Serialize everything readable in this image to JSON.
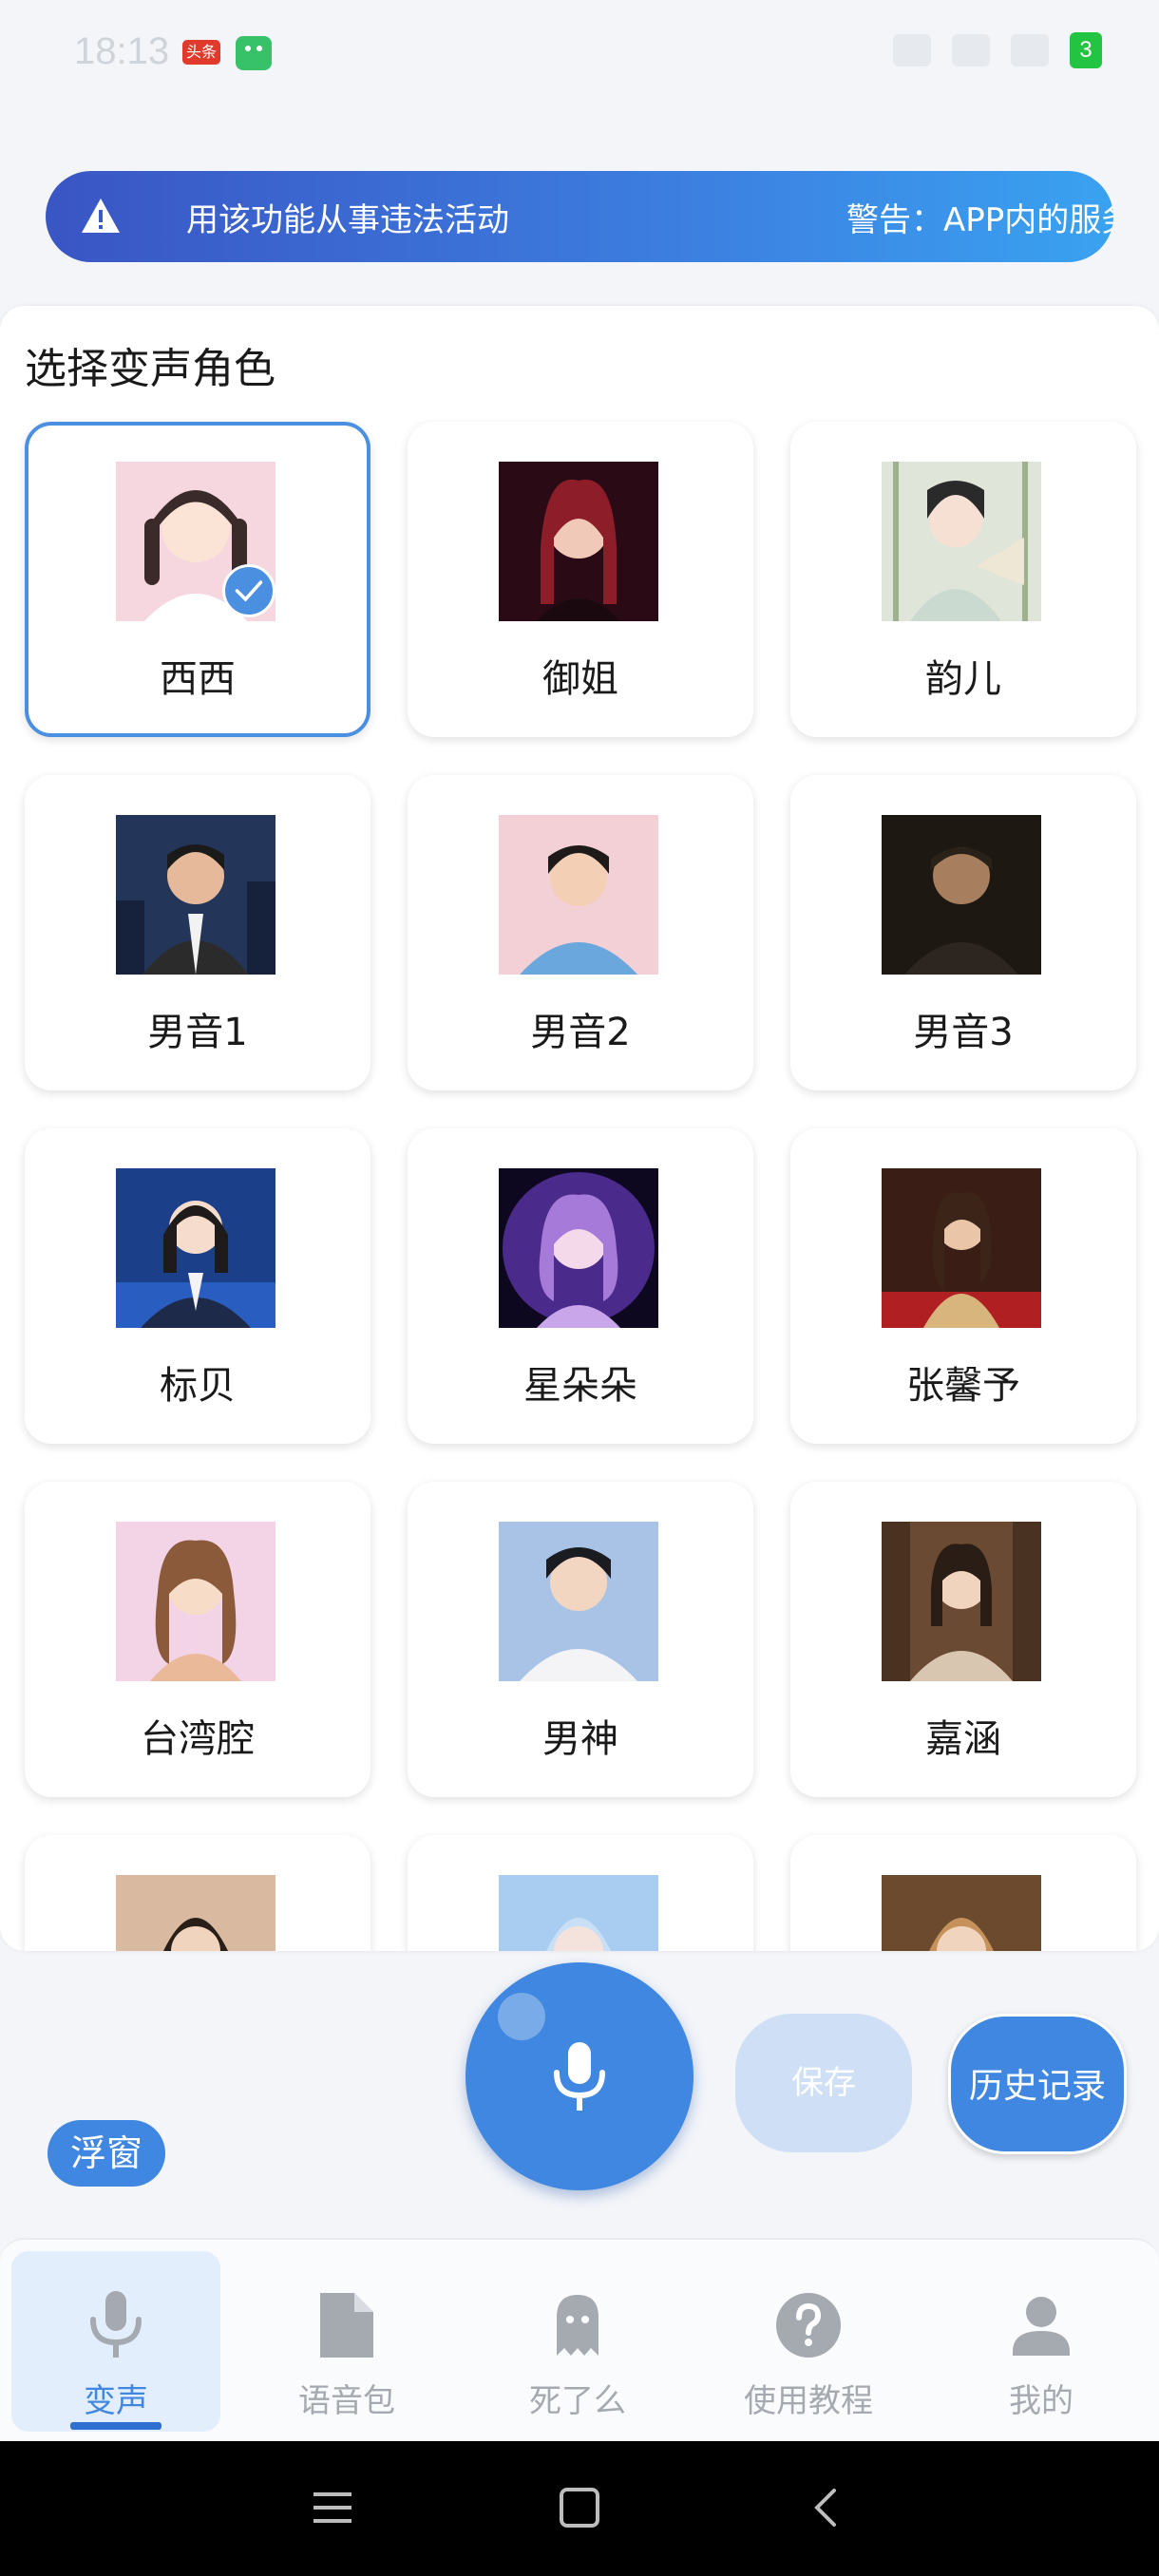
{
  "status_bar": {
    "time": "18:13",
    "badge_text": "头条",
    "battery": "3"
  },
  "banner": {
    "text_1": "用该功能从事违法活动",
    "text_2": "警告：APP内的服务"
  },
  "panel": {
    "title": "选择变声角色",
    "roles": [
      {
        "label": "西西",
        "selected": true
      },
      {
        "label": "御姐",
        "selected": false
      },
      {
        "label": "韵儿",
        "selected": false
      },
      {
        "label": "男音1",
        "selected": false
      },
      {
        "label": "男音2",
        "selected": false
      },
      {
        "label": "男音3",
        "selected": false
      },
      {
        "label": "标贝",
        "selected": false
      },
      {
        "label": "星朵朵",
        "selected": false
      },
      {
        "label": "张馨予",
        "selected": false
      },
      {
        "label": "台湾腔",
        "selected": false
      },
      {
        "label": "男神",
        "selected": false
      },
      {
        "label": "嘉涵",
        "selected": false
      }
    ]
  },
  "controls": {
    "save_label": "保存",
    "history_label": "历史记录",
    "float_label": "浮窗",
    "mic_icon": "microphone-icon"
  },
  "bottom_nav": {
    "items": [
      {
        "label": "变声",
        "icon": "microphone-icon",
        "active": true
      },
      {
        "label": "语音包",
        "icon": "file-icon",
        "active": false
      },
      {
        "label": "死了么",
        "icon": "ghost-icon",
        "active": false
      },
      {
        "label": "使用教程",
        "icon": "help-icon",
        "active": false
      },
      {
        "label": "我的",
        "icon": "person-icon",
        "active": false
      }
    ]
  },
  "colors": {
    "accent": "#3f87e0",
    "accent_light": "#cfe0f6",
    "nav_inactive": "#a5a9b0"
  }
}
